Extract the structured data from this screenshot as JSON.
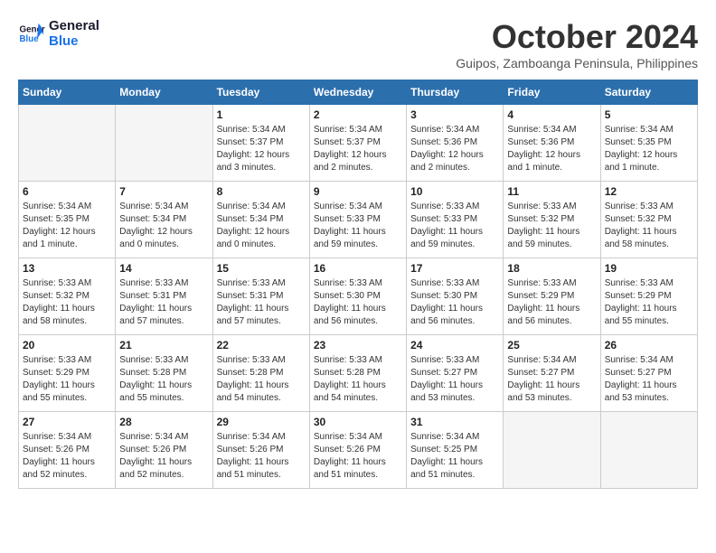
{
  "header": {
    "logo_line1": "General",
    "logo_line2": "Blue",
    "month": "October 2024",
    "location": "Guipos, Zamboanga Peninsula, Philippines"
  },
  "weekdays": [
    "Sunday",
    "Monday",
    "Tuesday",
    "Wednesday",
    "Thursday",
    "Friday",
    "Saturday"
  ],
  "weeks": [
    [
      {
        "day": "",
        "info": ""
      },
      {
        "day": "",
        "info": ""
      },
      {
        "day": "1",
        "info": "Sunrise: 5:34 AM\nSunset: 5:37 PM\nDaylight: 12 hours\nand 3 minutes."
      },
      {
        "day": "2",
        "info": "Sunrise: 5:34 AM\nSunset: 5:37 PM\nDaylight: 12 hours\nand 2 minutes."
      },
      {
        "day": "3",
        "info": "Sunrise: 5:34 AM\nSunset: 5:36 PM\nDaylight: 12 hours\nand 2 minutes."
      },
      {
        "day": "4",
        "info": "Sunrise: 5:34 AM\nSunset: 5:36 PM\nDaylight: 12 hours\nand 1 minute."
      },
      {
        "day": "5",
        "info": "Sunrise: 5:34 AM\nSunset: 5:35 PM\nDaylight: 12 hours\nand 1 minute."
      }
    ],
    [
      {
        "day": "6",
        "info": "Sunrise: 5:34 AM\nSunset: 5:35 PM\nDaylight: 12 hours\nand 1 minute."
      },
      {
        "day": "7",
        "info": "Sunrise: 5:34 AM\nSunset: 5:34 PM\nDaylight: 12 hours\nand 0 minutes."
      },
      {
        "day": "8",
        "info": "Sunrise: 5:34 AM\nSunset: 5:34 PM\nDaylight: 12 hours\nand 0 minutes."
      },
      {
        "day": "9",
        "info": "Sunrise: 5:34 AM\nSunset: 5:33 PM\nDaylight: 11 hours\nand 59 minutes."
      },
      {
        "day": "10",
        "info": "Sunrise: 5:33 AM\nSunset: 5:33 PM\nDaylight: 11 hours\nand 59 minutes."
      },
      {
        "day": "11",
        "info": "Sunrise: 5:33 AM\nSunset: 5:32 PM\nDaylight: 11 hours\nand 59 minutes."
      },
      {
        "day": "12",
        "info": "Sunrise: 5:33 AM\nSunset: 5:32 PM\nDaylight: 11 hours\nand 58 minutes."
      }
    ],
    [
      {
        "day": "13",
        "info": "Sunrise: 5:33 AM\nSunset: 5:32 PM\nDaylight: 11 hours\nand 58 minutes."
      },
      {
        "day": "14",
        "info": "Sunrise: 5:33 AM\nSunset: 5:31 PM\nDaylight: 11 hours\nand 57 minutes."
      },
      {
        "day": "15",
        "info": "Sunrise: 5:33 AM\nSunset: 5:31 PM\nDaylight: 11 hours\nand 57 minutes."
      },
      {
        "day": "16",
        "info": "Sunrise: 5:33 AM\nSunset: 5:30 PM\nDaylight: 11 hours\nand 56 minutes."
      },
      {
        "day": "17",
        "info": "Sunrise: 5:33 AM\nSunset: 5:30 PM\nDaylight: 11 hours\nand 56 minutes."
      },
      {
        "day": "18",
        "info": "Sunrise: 5:33 AM\nSunset: 5:29 PM\nDaylight: 11 hours\nand 56 minutes."
      },
      {
        "day": "19",
        "info": "Sunrise: 5:33 AM\nSunset: 5:29 PM\nDaylight: 11 hours\nand 55 minutes."
      }
    ],
    [
      {
        "day": "20",
        "info": "Sunrise: 5:33 AM\nSunset: 5:29 PM\nDaylight: 11 hours\nand 55 minutes."
      },
      {
        "day": "21",
        "info": "Sunrise: 5:33 AM\nSunset: 5:28 PM\nDaylight: 11 hours\nand 55 minutes."
      },
      {
        "day": "22",
        "info": "Sunrise: 5:33 AM\nSunset: 5:28 PM\nDaylight: 11 hours\nand 54 minutes."
      },
      {
        "day": "23",
        "info": "Sunrise: 5:33 AM\nSunset: 5:28 PM\nDaylight: 11 hours\nand 54 minutes."
      },
      {
        "day": "24",
        "info": "Sunrise: 5:33 AM\nSunset: 5:27 PM\nDaylight: 11 hours\nand 53 minutes."
      },
      {
        "day": "25",
        "info": "Sunrise: 5:34 AM\nSunset: 5:27 PM\nDaylight: 11 hours\nand 53 minutes."
      },
      {
        "day": "26",
        "info": "Sunrise: 5:34 AM\nSunset: 5:27 PM\nDaylight: 11 hours\nand 53 minutes."
      }
    ],
    [
      {
        "day": "27",
        "info": "Sunrise: 5:34 AM\nSunset: 5:26 PM\nDaylight: 11 hours\nand 52 minutes."
      },
      {
        "day": "28",
        "info": "Sunrise: 5:34 AM\nSunset: 5:26 PM\nDaylight: 11 hours\nand 52 minutes."
      },
      {
        "day": "29",
        "info": "Sunrise: 5:34 AM\nSunset: 5:26 PM\nDaylight: 11 hours\nand 51 minutes."
      },
      {
        "day": "30",
        "info": "Sunrise: 5:34 AM\nSunset: 5:26 PM\nDaylight: 11 hours\nand 51 minutes."
      },
      {
        "day": "31",
        "info": "Sunrise: 5:34 AM\nSunset: 5:25 PM\nDaylight: 11 hours\nand 51 minutes."
      },
      {
        "day": "",
        "info": ""
      },
      {
        "day": "",
        "info": ""
      }
    ]
  ]
}
